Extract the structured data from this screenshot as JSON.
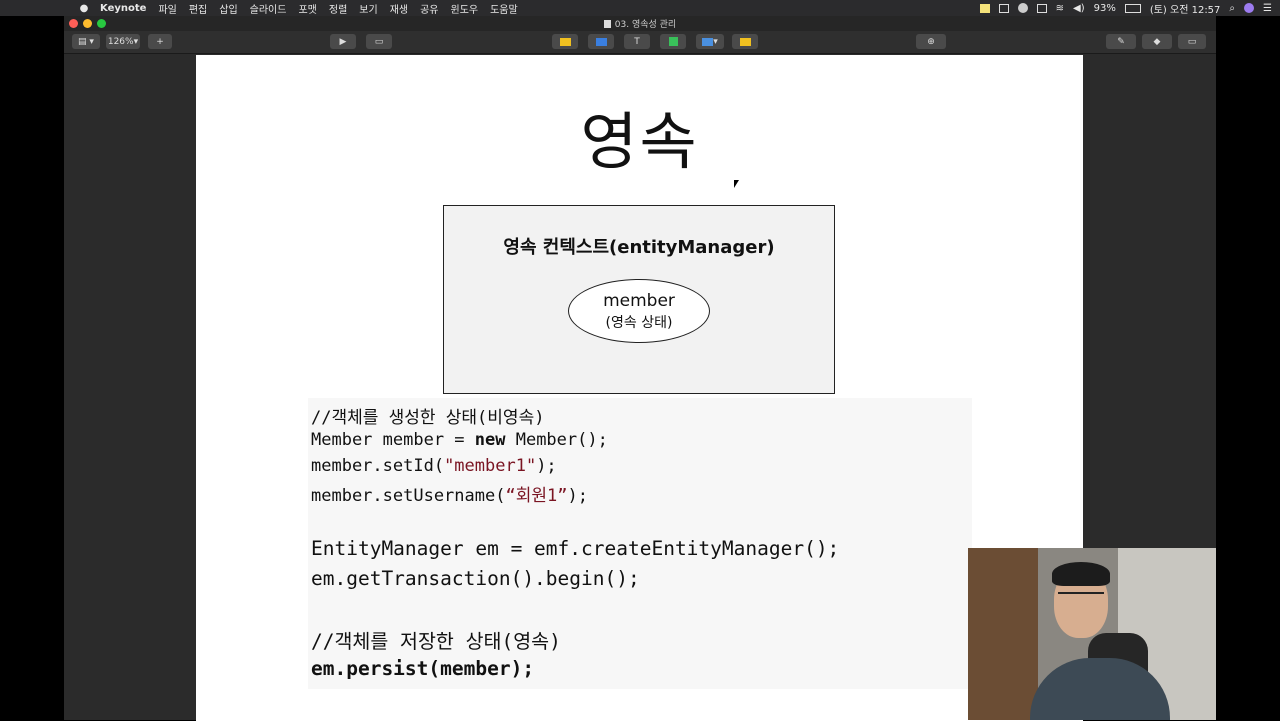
{
  "menubar": {
    "app_name": "Keynote",
    "menus": [
      "파일",
      "편집",
      "삽입",
      "슬라이드",
      "포맷",
      "정렬",
      "보기",
      "재생",
      "공유",
      "윈도우",
      "도움말"
    ],
    "battery": "93%",
    "clock": "(토) 오전 12:57"
  },
  "window": {
    "title": "03. 영속성 관리"
  },
  "toolbar": {
    "zoom": "126%"
  },
  "slide": {
    "title": "영속",
    "context_label": "영속 컨텍스트(entityManager)",
    "entity_name": "member",
    "entity_state": "(영속 상태)",
    "code": {
      "line1": "//객체를 생성한 상태(비영속)",
      "line2_plain": "Member member = ",
      "line2_kw": "new",
      "line2_rest": " Member();",
      "line3_a": "member.setId(",
      "line3_str": "\"member1\"",
      "line3_b": ");",
      "line4_a": "member.setUsername(",
      "line4_str": "“회원1”",
      "line4_b": ");",
      "line5": "EntityManager em = emf.createEntityManager();",
      "line6": "em.getTransaction().begin();",
      "line7": "//객체를 저장한 상태(영속)",
      "line8": "em.persist(member);"
    }
  },
  "colors": {
    "menubar_bg": "#2b2b2d",
    "slide_bg": "#ffffff",
    "context_box_bg": "#f2f2f2",
    "string_color": "#7a1422"
  },
  "icons": [
    "apple-icon",
    "wifi-icon",
    "bluetooth-icon",
    "volume-icon",
    "battery-icon",
    "search-icon",
    "siri-icon",
    "list-icon"
  ]
}
